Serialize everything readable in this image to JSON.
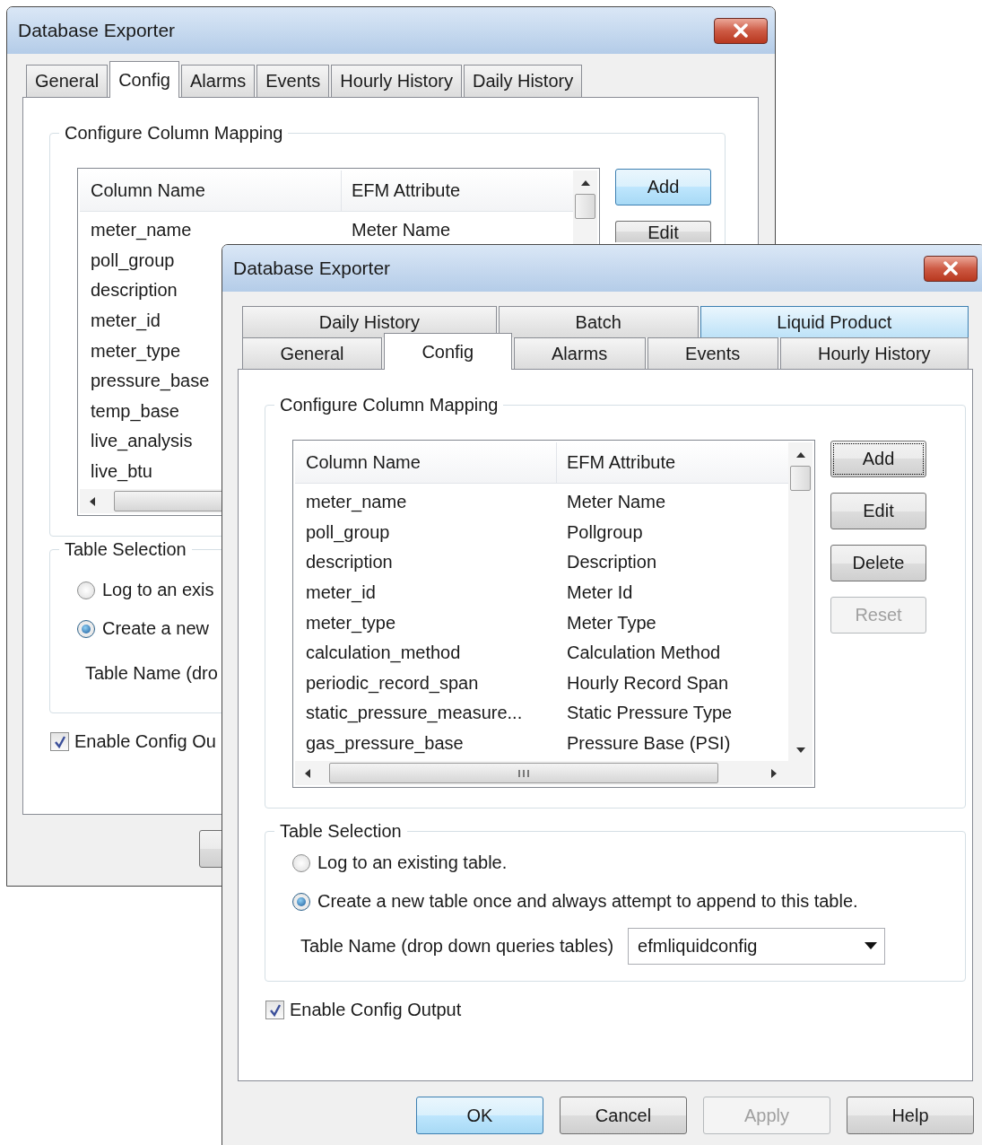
{
  "windows": [
    {
      "kind": "back",
      "title": "Database Exporter",
      "tab_rows": [
        [
          {
            "label": "General",
            "selected": false
          },
          {
            "label": "Config",
            "selected": true
          },
          {
            "label": "Alarms",
            "selected": false
          },
          {
            "label": "Events",
            "selected": false
          },
          {
            "label": "Hourly History",
            "selected": false
          },
          {
            "label": "Daily History",
            "selected": false
          }
        ]
      ],
      "column_mapping": {
        "title": "Configure Column Mapping",
        "columns": [
          "Column Name",
          "EFM Attribute"
        ],
        "rows": [
          {
            "column_name": "meter_name",
            "attribute": "Meter Name"
          },
          {
            "column_name": "poll_group"
          },
          {
            "column_name": "description"
          },
          {
            "column_name": "meter_id"
          },
          {
            "column_name": "meter_type"
          },
          {
            "column_name": "pressure_base"
          },
          {
            "column_name": "temp_base"
          },
          {
            "column_name": "live_analysis"
          },
          {
            "column_name": "live_btu"
          }
        ],
        "buttons": [
          {
            "label": "Add",
            "default": true,
            "focused": false,
            "disabled": false
          },
          {
            "label": "Edit",
            "default": false,
            "focused": false,
            "disabled": false
          }
        ]
      },
      "table_selection": {
        "title": "Table Selection",
        "options": [
          {
            "label": "Log to an exis",
            "selected": false
          },
          {
            "label": "Create a new",
            "selected": true
          }
        ],
        "table_name": {
          "label": "Table Name (dro"
        }
      },
      "enable_config_output": {
        "label": "Enable Config Ou",
        "checked": true
      }
    },
    {
      "kind": "front",
      "title": "Database Exporter",
      "tab_rows": [
        [
          {
            "label": "Daily History",
            "selected": false,
            "highlighted": false
          },
          {
            "label": "Batch",
            "selected": false,
            "highlighted": false
          },
          {
            "label": "Liquid Product",
            "selected": false,
            "highlighted": true
          }
        ],
        [
          {
            "label": "General",
            "selected": false,
            "highlighted": false
          },
          {
            "label": "Config",
            "selected": true,
            "highlighted": false
          },
          {
            "label": "Alarms",
            "selected": false,
            "highlighted": false
          },
          {
            "label": "Events",
            "selected": false,
            "highlighted": false
          },
          {
            "label": "Hourly History",
            "selected": false,
            "highlighted": false
          }
        ]
      ],
      "column_mapping": {
        "title": "Configure Column Mapping",
        "columns": [
          "Column Name",
          "EFM Attribute"
        ],
        "rows": [
          {
            "column_name": "meter_name",
            "attribute": "Meter Name"
          },
          {
            "column_name": "poll_group",
            "attribute": "Pollgroup"
          },
          {
            "column_name": "description",
            "attribute": "Description"
          },
          {
            "column_name": "meter_id",
            "attribute": "Meter Id"
          },
          {
            "column_name": "meter_type",
            "attribute": "Meter Type"
          },
          {
            "column_name": "calculation_method",
            "attribute": "Calculation Method"
          },
          {
            "column_name": "periodic_record_span",
            "attribute": "Hourly Record Span"
          },
          {
            "column_name": "static_pressure_measure...",
            "attribute": "Static Pressure Type"
          },
          {
            "column_name": "gas_pressure_base",
            "attribute": "Pressure Base (PSI)"
          }
        ],
        "buttons": [
          {
            "label": "Add",
            "default": false,
            "focused": true,
            "disabled": false
          },
          {
            "label": "Edit",
            "default": false,
            "focused": false,
            "disabled": false
          },
          {
            "label": "Delete",
            "default": false,
            "focused": false,
            "disabled": false
          },
          {
            "label": "Reset",
            "default": false,
            "focused": false,
            "disabled": true
          }
        ]
      },
      "table_selection": {
        "title": "Table Selection",
        "options": [
          {
            "label": "Log to an existing table.",
            "selected": false
          },
          {
            "label": "Create a new table once and always attempt to append to this table.",
            "selected": true
          }
        ],
        "table_name": {
          "label": "Table Name (drop down queries tables)",
          "value": "efmliquidconfig"
        }
      },
      "enable_config_output": {
        "label": "Enable Config Output",
        "checked": true
      },
      "footer_buttons": [
        {
          "label": "OK",
          "default": true,
          "focused": false,
          "disabled": false
        },
        {
          "label": "Cancel",
          "default": false,
          "focused": false,
          "disabled": false
        },
        {
          "label": "Apply",
          "default": false,
          "focused": false,
          "disabled": true
        },
        {
          "label": "Help",
          "default": false,
          "focused": false,
          "disabled": false
        }
      ]
    }
  ]
}
